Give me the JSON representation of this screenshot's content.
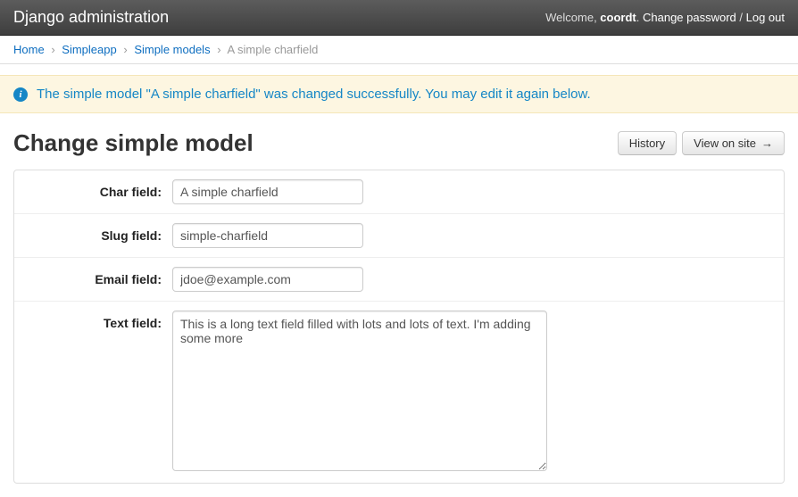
{
  "navbar": {
    "brand": "Django administration",
    "welcome_prefix": "Welcome, ",
    "username": "coordt",
    "welcome_suffix": ". ",
    "change_password": "Change password",
    "sep": " / ",
    "logout": "Log out"
  },
  "breadcrumb": {
    "home": "Home",
    "app": "Simpleapp",
    "model": "Simple models",
    "current": "A simple charfield",
    "sep": "›"
  },
  "alert": {
    "message": "The simple model \"A simple charfield\" was changed successfully. You may edit it again below."
  },
  "header": {
    "title": "Change simple model",
    "history": "History",
    "view_on_site": "View on site"
  },
  "form": {
    "char_field": {
      "label": "Char field:",
      "value": "A simple charfield"
    },
    "slug_field": {
      "label": "Slug field:",
      "value": "simple-charfield"
    },
    "email_field": {
      "label": "Email field:",
      "value": "jdoe@example.com"
    },
    "text_field": {
      "label": "Text field:",
      "value": "This is a long text field filled with lots and lots of text. I'm adding some more"
    }
  }
}
